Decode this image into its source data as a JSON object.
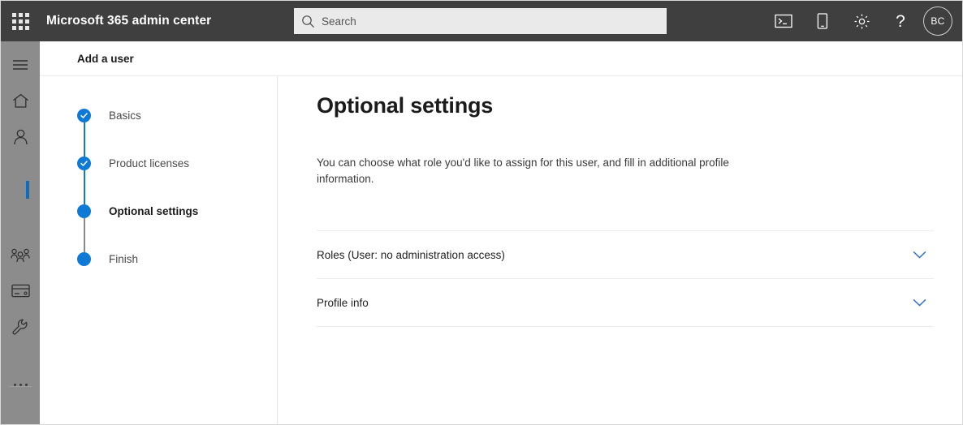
{
  "topbar": {
    "waffle_label": "app-launcher",
    "suite_title": "Microsoft 365 admin center",
    "search": {
      "placeholder": "Search",
      "value": ""
    },
    "actions": [
      {
        "name": "console-icon",
        "label": "Console"
      },
      {
        "name": "mobile-device-icon",
        "label": "Mobile"
      },
      {
        "name": "gear-icon",
        "label": "Settings"
      },
      {
        "name": "help-icon",
        "label": "?"
      }
    ],
    "avatar_initials": "BC",
    "background_color": "#3f3f3f"
  },
  "rail": {
    "background_color": "#8c8c8c",
    "active_indicator_color": "#0f6cbd",
    "items": [
      {
        "name": "hamburger-menu-icon",
        "label": "Menu"
      },
      {
        "name": "home-icon",
        "label": "Home"
      },
      {
        "name": "user-icon",
        "label": "Users"
      },
      {
        "name": "teams-groups-icon",
        "label": "Teams & groups"
      },
      {
        "name": "billing-card-icon",
        "label": "Billing"
      },
      {
        "name": "setup-wrench-icon",
        "label": "Setup"
      },
      {
        "name": "show-all-ellipsis-icon",
        "label": "Show all"
      }
    ]
  },
  "page_header": {
    "title": "Add a user"
  },
  "wizard": {
    "steps": [
      {
        "label": "Basics",
        "state": "completed"
      },
      {
        "label": "Product licenses",
        "state": "completed"
      },
      {
        "label": "Optional settings",
        "state": "current"
      },
      {
        "label": "Finish",
        "state": "upcoming"
      }
    ],
    "accent_color": "#0f7ad6"
  },
  "main": {
    "heading": "Optional settings",
    "description": "You can choose what role you'd like to assign for this user, and fill in additional profile information.",
    "sections": [
      {
        "title": "Roles (User: no administration access)",
        "expanded": false,
        "chevron": "chevron-down-icon"
      },
      {
        "title": "Profile info",
        "expanded": false,
        "chevron": "chevron-down-icon"
      }
    ],
    "chevron_color": "#3b78c8"
  }
}
